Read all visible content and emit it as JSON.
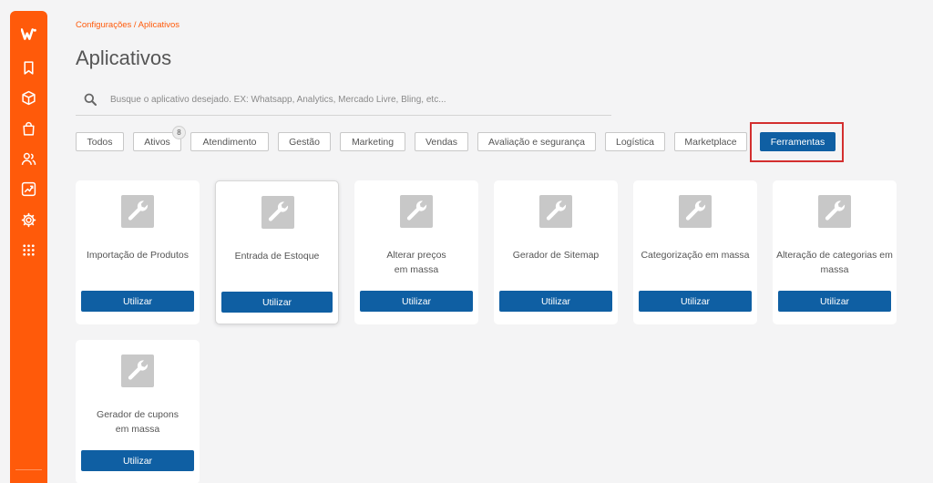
{
  "sidebar": {
    "icons": [
      "logo-w-icon",
      "bookmark-icon",
      "box-icon",
      "shopping-bag-icon",
      "users-icon",
      "chart-trending-icon",
      "gear-icon",
      "apps-grid-icon"
    ]
  },
  "breadcrumb": "Configurações / Aplicativos",
  "page_title": "Aplicativos",
  "search": {
    "placeholder": "Busque o aplicativo desejado. EX: Whatsapp, Analytics, Mercado Livre, Bling, etc...",
    "value": ""
  },
  "filters": [
    {
      "label": "Todos",
      "active": false
    },
    {
      "label": "Ativos",
      "active": false,
      "badge": "8"
    },
    {
      "label": "Atendimento",
      "active": false
    },
    {
      "label": "Gestão",
      "active": false
    },
    {
      "label": "Marketing",
      "active": false
    },
    {
      "label": "Vendas",
      "active": false
    },
    {
      "label": "Avaliação e segurança",
      "active": false
    },
    {
      "label": "Logística",
      "active": false
    },
    {
      "label": "Marketplace",
      "active": false
    },
    {
      "label": "Ferramentas",
      "active": true
    }
  ],
  "apps": [
    {
      "name": "Importação de Produtos",
      "button": "Utilizar",
      "icon": "wrench-icon"
    },
    {
      "name": "Entrada de Estoque",
      "button": "Utilizar",
      "icon": "wrench-icon",
      "selected": true
    },
    {
      "name": "Alterar preços em massa",
      "button": "Utilizar",
      "icon": "wrench-icon"
    },
    {
      "name": "Gerador de Sitemap",
      "button": "Utilizar",
      "icon": "wrench-icon"
    },
    {
      "name": "Categorização em massa",
      "button": "Utilizar",
      "icon": "wrench-icon"
    },
    {
      "name": "Alteração de categorias em massa",
      "button": "Utilizar",
      "icon": "wrench-icon"
    },
    {
      "name": "Gerador de cupons em massa",
      "button": "Utilizar",
      "icon": "wrench-icon"
    }
  ],
  "colors": {
    "brand": "#ff5a0a",
    "primary_button": "#0f5fa3",
    "highlight": "#d32f2f",
    "background": "#f4f4f5"
  }
}
